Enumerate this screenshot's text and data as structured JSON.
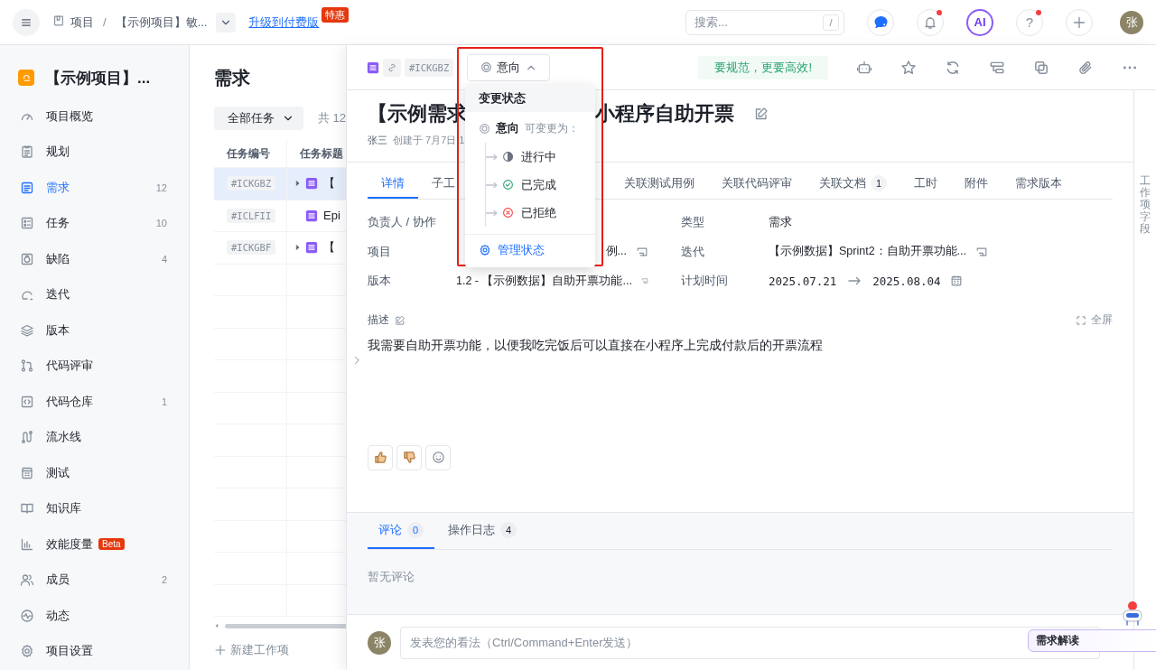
{
  "topbar": {
    "root": "项目",
    "separator": "/",
    "project": "【示例项目】敏...",
    "upgrade_link": "升级到付费版",
    "upgrade_badge": "特惠",
    "search": {
      "placeholder": "搜索...",
      "shortcut": "/"
    },
    "actions": [
      {
        "kind": "chat",
        "dot": false
      },
      {
        "kind": "bell",
        "dot": true
      },
      {
        "kind": "ai",
        "label": "AI",
        "dot": false
      },
      {
        "kind": "help",
        "label": "?",
        "dot": true
      },
      {
        "kind": "add",
        "dot": false
      }
    ],
    "avatar": "张"
  },
  "sidebar": {
    "project": "【示例项目】...",
    "items": [
      {
        "label": "项目概览",
        "selected": false
      },
      {
        "label": "规划",
        "selected": false
      },
      {
        "label": "需求",
        "count": "12",
        "selected": true
      },
      {
        "label": "任务",
        "count": "10",
        "selected": false
      },
      {
        "label": "缺陷",
        "count": "4",
        "selected": false
      },
      {
        "label": "迭代",
        "selected": false
      },
      {
        "label": "版本",
        "selected": false
      },
      {
        "label": "代码评审",
        "selected": false
      },
      {
        "label": "代码仓库",
        "count": "1",
        "selected": false
      },
      {
        "label": "流水线",
        "selected": false
      },
      {
        "label": "测试",
        "selected": false
      },
      {
        "label": "知识库",
        "selected": false
      },
      {
        "label": "效能度量",
        "badge": "Beta",
        "selected": false
      },
      {
        "label": "成员",
        "count": "2",
        "selected": false
      },
      {
        "label": "动态",
        "selected": false
      },
      {
        "label": "项目设置",
        "selected": false
      }
    ]
  },
  "list": {
    "title": "需求",
    "filter": "全部任务",
    "total": "共 12",
    "columns": [
      "任务编号",
      "任务标题"
    ],
    "rows": [
      {
        "id": "#ICKGBZ",
        "title": "【",
        "expandable": true,
        "selected": true
      },
      {
        "id": "#ICLFII",
        "title": "Epi",
        "expandable": false,
        "selected": false
      },
      {
        "id": "#ICKGBF",
        "title": "【",
        "expandable": true,
        "selected": false
      }
    ],
    "new_item": "新建工作项"
  },
  "detail": {
    "id": "#ICKGBZ",
    "status": {
      "label": "意向",
      "expanded": true
    },
    "slogan": "要规范，更要高效!",
    "title_start": "【示例需求",
    "title_end": "小程序自助开票",
    "author": "张三",
    "created": "创建于 7月7日 1",
    "tabs": [
      {
        "label": "详情",
        "selected": true
      },
      {
        "label": "子工",
        "selected": false
      },
      {
        "label": "关联测试用例",
        "selected": false
      },
      {
        "label": "关联代码评审",
        "selected": false
      },
      {
        "label": "关联文档",
        "count": "1",
        "selected": false
      },
      {
        "label": "工时",
        "selected": false
      },
      {
        "label": "附件",
        "selected": false
      },
      {
        "label": "需求版本",
        "selected": false
      }
    ],
    "fields": [
      {
        "label": "负责人 / 协作"
      },
      {
        "label": "类型",
        "value": "需求"
      },
      {
        "label": "项目",
        "value": "例...",
        "link": true
      },
      {
        "label": "迭代",
        "value": "【示例数据】Sprint2：自助开票功能...",
        "link": true
      },
      {
        "label": "版本",
        "value": "1.2 - 【示例数据】自助开票功能...",
        "link": true
      },
      {
        "label": "计划时间",
        "kind": "date_range",
        "start": "2025.07.21",
        "end": "2025.08.04"
      }
    ],
    "description": {
      "label": "描述",
      "fullscreen": "全屏",
      "text": "我需要自助开票功能，以便我吃完饭后可以直接在小程序上完成付款后的开票流程"
    },
    "activity": {
      "tabs": [
        {
          "label": "评论",
          "count": "0",
          "selected": true
        },
        {
          "label": "操作日志",
          "count": "4",
          "selected": false
        }
      ],
      "empty": "暂无评论"
    },
    "comment": {
      "avatar": "张",
      "placeholder": "发表您的看法（Ctrl/Command+Enter发送）"
    },
    "assistant_chip": "需求解读",
    "side_panel": "工作项字段"
  },
  "status_menu": {
    "title": "变更状态",
    "current": "意向",
    "hint": "可变更为：",
    "options": [
      {
        "label": "进行中",
        "kind": "in_progress"
      },
      {
        "label": "已完成",
        "kind": "done"
      },
      {
        "label": "已拒绝",
        "kind": "rejected"
      }
    ],
    "manage": "管理状态"
  }
}
